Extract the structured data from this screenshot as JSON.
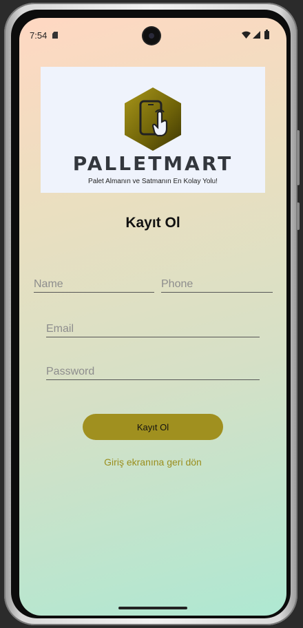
{
  "status_bar": {
    "time": "7:54",
    "icons": [
      "sd-card-icon",
      "wifi-icon",
      "signal-icon",
      "battery-icon"
    ]
  },
  "logo": {
    "brand_name": "PALLETMART",
    "tagline": "Palet Almanın ve Satmanın En Kolay Yolu!",
    "icon": "phone-touch-icon",
    "colors": {
      "hex_fill": "#8a7a10",
      "brand_text": "#33373d",
      "logo_bg": "#eff3fc"
    }
  },
  "page": {
    "title": "Kayıt Ol"
  },
  "form": {
    "name_placeholder": "Name",
    "phone_placeholder": "Phone",
    "email_placeholder": "Email",
    "password_placeholder": "Password"
  },
  "actions": {
    "register_label": "Kayıt Ol",
    "back_link_label": "Giriş ekranına geri dön"
  },
  "colors": {
    "accent": "#a0901f",
    "link": "#9a8e1e",
    "gradient_top": "#ffd8c2",
    "gradient_bottom": "#aee8d2"
  }
}
